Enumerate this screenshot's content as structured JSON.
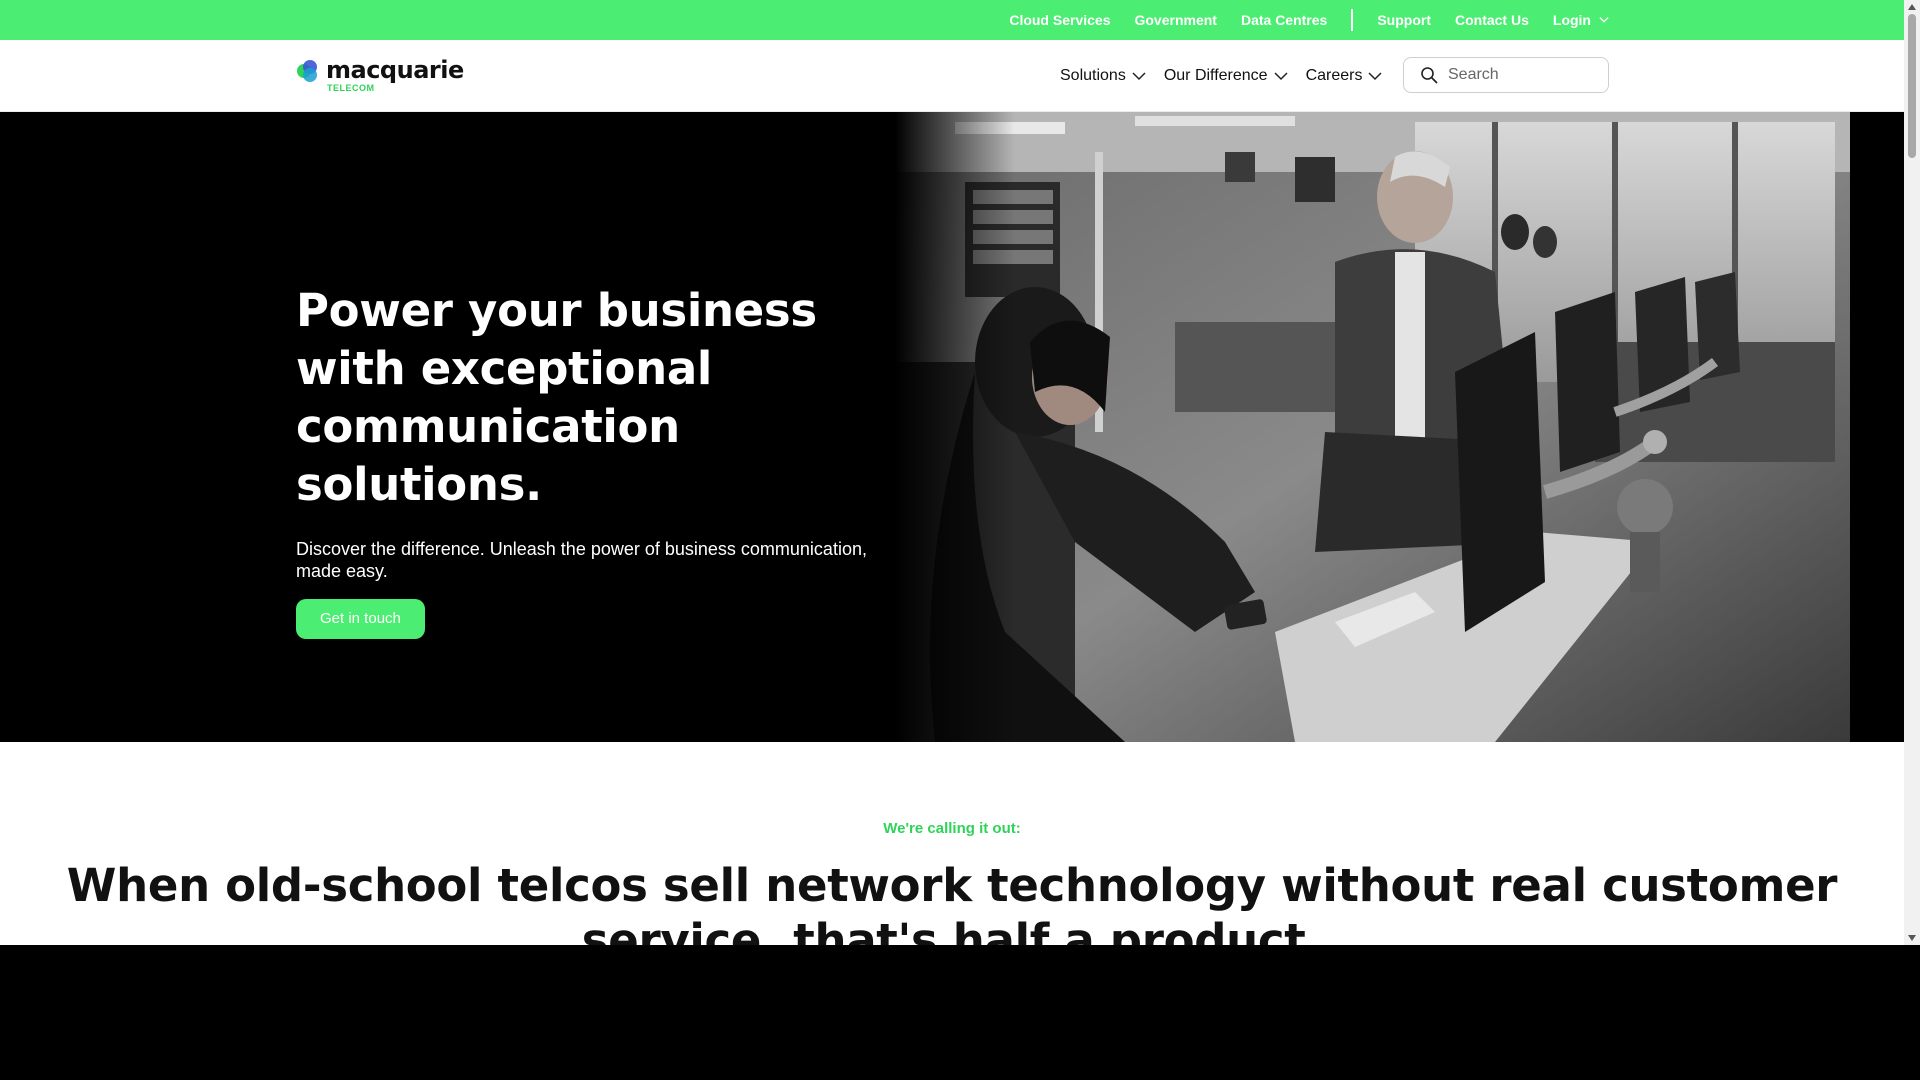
{
  "utility_bar": {
    "links": [
      "Cloud Services",
      "Government",
      "Data Centres"
    ],
    "secondary_links": [
      "Support",
      "Contact Us"
    ],
    "login_label": "Login"
  },
  "nav": {
    "logo_word": "macquarie",
    "logo_sub": "TELECOM",
    "items": [
      "Solutions",
      "Our Difference",
      "Careers"
    ],
    "search_placeholder": "Search"
  },
  "hero": {
    "title": "Power your business with exceptional communication solutions.",
    "subtitle": "Discover the difference. Unleash the power of business communication, made easy.",
    "cta_label": "Get in touch"
  },
  "intro": {
    "eyebrow": "We're calling it out:",
    "heading": "When old-school telcos sell network technology without real customer service, that's half a product."
  },
  "colors": {
    "brand_green": "#4bed72",
    "hero_background": "#000000"
  }
}
